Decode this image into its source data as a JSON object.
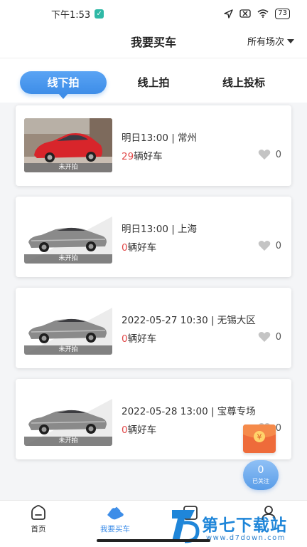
{
  "status_bar": {
    "time": "下午1:53",
    "battery": "73"
  },
  "header": {
    "title": "我要买车",
    "filter_label": "所有场次"
  },
  "tabs": [
    {
      "label": "线下拍",
      "active": true
    },
    {
      "label": "线上拍",
      "active": false
    },
    {
      "label": "线上投标",
      "active": false
    }
  ],
  "auctions": [
    {
      "status": "未开拍",
      "time": "明日13:00 | 常州",
      "count": "29",
      "count_suffix": "辆好车",
      "favorites": "0",
      "image": "red-sedan-photo"
    },
    {
      "status": "未开拍",
      "time": "明日13:00 | 上海",
      "count": "0",
      "count_suffix": "辆好车",
      "favorites": "0",
      "image": "silver-sedan-placeholder"
    },
    {
      "status": "未开拍",
      "time": "2022-05-27 10:30 | 无锡大区",
      "count": "0",
      "count_suffix": "辆好车",
      "favorites": "0",
      "image": "silver-sedan-placeholder"
    },
    {
      "status": "未开拍",
      "time": "2022-05-28 13:00 | 宝尊专场",
      "count": "0",
      "count_suffix": "辆好车",
      "favorites": "0",
      "image": "silver-sedan-placeholder"
    }
  ],
  "floating": {
    "red_envelope_symbol": "¥",
    "follow_count": "0",
    "follow_label": "已关注"
  },
  "bottom_nav": [
    {
      "label": "首页",
      "icon": "home-icon",
      "active": false
    },
    {
      "label": "我要买车",
      "icon": "car-icon",
      "active": true
    },
    {
      "label": "",
      "icon": "order-icon",
      "active": false
    },
    {
      "label": "",
      "icon": "profile-icon",
      "active": false
    }
  ],
  "watermark": {
    "text": "第七下载站",
    "url": "www.d7down.com"
  },
  "colors": {
    "accent": "#3d8de8",
    "count_red": "#e04848",
    "envelope": "#ee6b3a"
  }
}
